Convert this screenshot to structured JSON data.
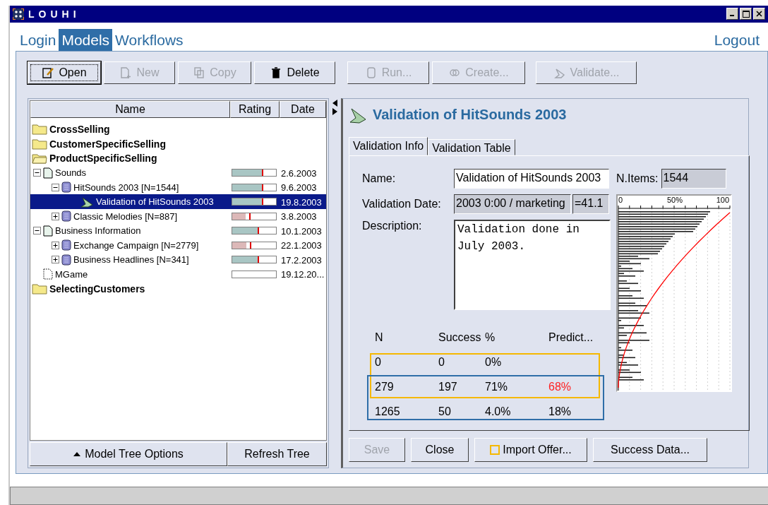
{
  "window": {
    "title": "LOUHI"
  },
  "nav": {
    "tabs": [
      {
        "label": "Login",
        "selected": false
      },
      {
        "label": "Models",
        "selected": true
      },
      {
        "label": "Workflows",
        "selected": false
      }
    ],
    "logout": "Logout"
  },
  "toolbar": [
    {
      "label": "Open",
      "kind": "open",
      "disabled": false
    },
    {
      "label": "New",
      "kind": "new",
      "disabled": true
    },
    {
      "label": "Copy",
      "kind": "copy",
      "disabled": true
    },
    {
      "label": "Delete",
      "kind": "delete",
      "disabled": false
    },
    {
      "label": "Run...",
      "kind": "run",
      "disabled": true
    },
    {
      "label": "Create...",
      "kind": "create",
      "disabled": true
    },
    {
      "label": "Validate...",
      "kind": "validate",
      "disabled": true
    }
  ],
  "tree": {
    "columns": [
      "Name",
      "Rating",
      "Date"
    ],
    "items": [
      {
        "label": "CrossSelling",
        "kind": "folder",
        "expanded": false,
        "selected": false
      },
      {
        "label": "CustomerSpecificSelling",
        "kind": "folder",
        "expanded": false,
        "selected": false
      },
      {
        "label": "ProductSpecificSelling",
        "kind": "folder",
        "expanded": true,
        "selected": false,
        "children": [
          {
            "label": "Sounds",
            "kind": "document",
            "expanded": true,
            "selected": false,
            "rating": {
              "level": 0.68,
              "color": "#a9c6c4"
            },
            "date": "2.6.2003",
            "children": [
              {
                "label": "HitSounds 2003 [N=1544]",
                "kind": "dataset",
                "expanded": true,
                "selected": false,
                "rating": {
                  "level": 0.68,
                  "color": "#a9c6c4"
                },
                "date": "9.6.2003",
                "children": [
                  {
                    "label": "Validation of HitSounds 2003",
                    "kind": "validation",
                    "selected": true,
                    "rating": {
                      "level": 0.68,
                      "color": "#a9c6c4"
                    },
                    "date": "19.8.2003"
                  }
                ]
              },
              {
                "label": "Classic Melodies [N=887]",
                "kind": "dataset",
                "expanded": false,
                "selected": false,
                "rating": {
                  "level": 0.3,
                  "color": "#dcb8b8"
                },
                "date": "3.8.2003"
              }
            ]
          },
          {
            "label": "Business Information",
            "kind": "document",
            "expanded": true,
            "selected": false,
            "rating": {
              "level": 0.58,
              "color": "#a9c6c4"
            },
            "date": "10.1.2003",
            "children": [
              {
                "label": "Exchange Campaign [N=2779]",
                "kind": "dataset",
                "expanded": false,
                "selected": false,
                "rating": {
                  "level": 0.33,
                  "color": "#dcb8b8"
                },
                "date": "22.1.2003"
              },
              {
                "label": "Business Headlines [N=341]",
                "kind": "dataset",
                "expanded": false,
                "selected": false,
                "rating": {
                  "level": 0.58,
                  "color": "#a9c6c4"
                },
                "date": "17.2.2003"
              }
            ]
          },
          {
            "label": "MGame",
            "kind": "empty",
            "selected": false,
            "date": "19.12.20..."
          }
        ]
      },
      {
        "label": "SelectingCustomers",
        "kind": "folder",
        "expanded": false,
        "selected": false
      }
    ],
    "footer": {
      "options": "Model Tree Options",
      "refresh": "Refresh Tree"
    }
  },
  "detail": {
    "title": "Validation of HitSounds 2003",
    "tabs": [
      {
        "label": "Validation Info",
        "selected": true
      },
      {
        "label": "Validation Table",
        "selected": false
      }
    ],
    "form": {
      "name_label": "Name:",
      "name": "Validation of HitSounds 2003",
      "date_label": "Validation Date:",
      "date": "2003 0:00 / marketing",
      "date_extra": "=41.1",
      "description_label": "Description:",
      "description": "Validation done in July 2003.",
      "items_label": "N.Items:",
      "items": "1544"
    },
    "chart": {
      "tick_labels": [
        "0",
        "50%",
        "100"
      ]
    },
    "table": {
      "columns": [
        "N",
        "Success",
        "%",
        "Predict..."
      ],
      "rows": [
        {
          "n": "0",
          "success": "0",
          "percent": "0%"
        },
        {
          "n": "279",
          "success": "197",
          "percent": "71%",
          "predict": "68%",
          "color": "#ff2020"
        },
        {
          "n": "1265",
          "success": "50",
          "percent": "4.0%",
          "predict": "18%",
          "color": "#000000"
        }
      ],
      "highlights": [
        {
          "color": "#f5b800"
        },
        {
          "color": "#2f6ea8"
        }
      ]
    },
    "buttons": [
      {
        "label": "Save",
        "kind": "plain",
        "disabled": true
      },
      {
        "label": "Close",
        "kind": "plain",
        "disabled": false
      },
      {
        "label": "Import Offer...",
        "kind": "swatch",
        "disabled": false
      },
      {
        "label": "Success Data...",
        "kind": "plain",
        "disabled": false
      }
    ]
  }
}
